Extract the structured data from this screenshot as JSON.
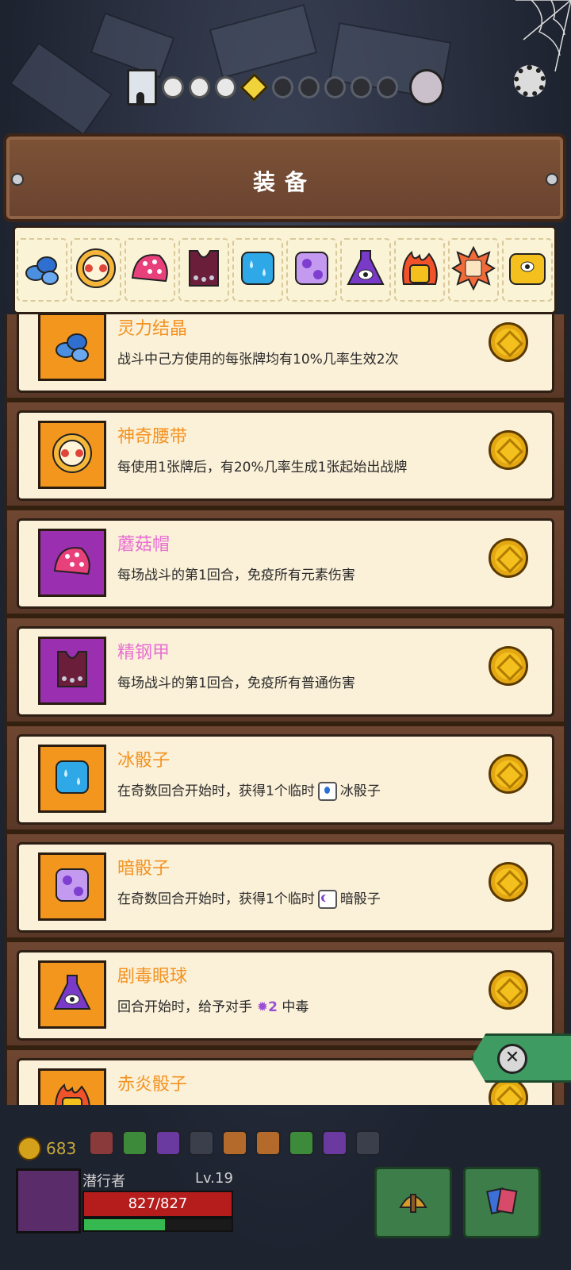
{
  "header": {
    "title": "装备"
  },
  "strip_icons": [
    "crystal-icon",
    "belt-icon",
    "mushroom-hat-icon",
    "steel-armor-icon",
    "ice-die-icon",
    "dark-die-icon",
    "poison-eye-icon",
    "fire-die-icon",
    "spiked-die-icon",
    "gold-die-icon"
  ],
  "items": [
    {
      "name": "灵力结晶",
      "desc": "战斗中己方使用的每张牌均有10%几率生效2次",
      "color": "orange",
      "icon": "crystal-icon"
    },
    {
      "name": "神奇腰带",
      "desc": "每使用1张牌后，有20%几率生成1张起始出战牌",
      "color": "orange",
      "icon": "belt-icon"
    },
    {
      "name": "蘑菇帽",
      "desc": "每场战斗的第1回合，免疫所有元素伤害",
      "color": "purple",
      "icon": "mushroom-hat-icon"
    },
    {
      "name": "精钢甲",
      "desc": "每场战斗的第1回合，免疫所有普通伤害",
      "color": "purple",
      "icon": "steel-armor-icon"
    },
    {
      "name": "冰骰子",
      "desc_pre": "在奇数回合开始时，获得1个临时",
      "desc_post": "冰骰子",
      "color": "orange",
      "icon": "ice-die-icon"
    },
    {
      "name": "暗骰子",
      "desc_pre": "在奇数回合开始时，获得1个临时",
      "desc_post": "暗骰子",
      "color": "orange",
      "icon": "dark-die-icon"
    },
    {
      "name": "剧毒眼球",
      "desc_pre": "回合开始时，给予对手",
      "desc_mark": "2",
      "desc_post": "中毒",
      "color": "orange",
      "icon": "poison-eye-icon"
    },
    {
      "name": "赤炎骰子",
      "desc": "",
      "color": "orange",
      "icon": "fire-die-icon"
    }
  ],
  "hud": {
    "coins": "683",
    "player_name": "潜行者",
    "level": "Lv.19",
    "hp": "827/827",
    "xp_fraction": 0.55
  },
  "colors": {
    "orange": "#f39321",
    "purple": "#e86fd3",
    "accent_green": "#3e9b62"
  }
}
